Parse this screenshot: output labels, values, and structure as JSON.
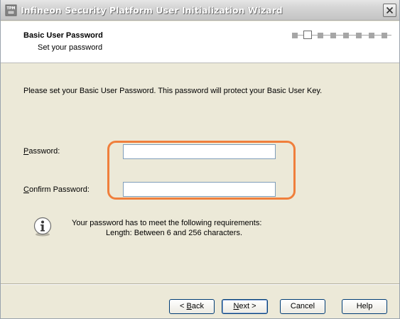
{
  "window": {
    "title": "Infineon Security Platform User Initialization Wizard",
    "icon": "tpm-chip-icon"
  },
  "header": {
    "title": "Basic User Password",
    "subtitle": "Set your password",
    "steps_total": 8,
    "current_step": 2
  },
  "main": {
    "intro": "Please set your Basic User Password. This password will protect your Basic User Key.",
    "password_label_accel": "P",
    "password_label_rest": "assword:",
    "password_value": "",
    "confirm_label_accel": "C",
    "confirm_label_rest": "onfirm Password:",
    "confirm_value": "",
    "requirements_line1": "Your password has to meet the following requirements:",
    "requirements_line2": "Length: Between 6 and 256 characters."
  },
  "buttons": {
    "back_pre": "< ",
    "back_accel": "B",
    "back_rest": "ack",
    "next_accel": "N",
    "next_rest": "ext >",
    "cancel": "Cancel",
    "help": "Help"
  },
  "colors": {
    "highlight": "#f07f3c",
    "dialog_bg": "#ece9d8"
  }
}
